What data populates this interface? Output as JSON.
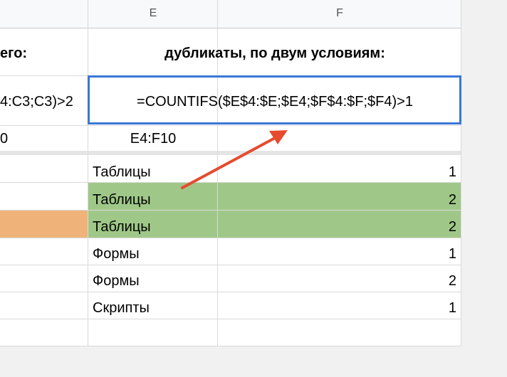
{
  "columns": {
    "e": "E",
    "f": "F"
  },
  "header_row": {
    "d_partial": "его:",
    "ef_title": "дубликаты, по двум условиям:"
  },
  "formula_row": {
    "d_partial": "4:C3;C3)>2",
    "ef_formula": "=COUNTIFS($E$4:$E;$E4;$F$4:$F;$F4)>1"
  },
  "range_row": {
    "d_partial": "0",
    "e_range": "E4:F10"
  },
  "rows": [
    {
      "e": "Таблицы",
      "f": "1",
      "highlight": false
    },
    {
      "e": "Таблицы",
      "f": "2",
      "highlight": true
    },
    {
      "e": "Таблицы",
      "f": "2",
      "highlight": true
    },
    {
      "e": "Формы",
      "f": "1",
      "highlight": false
    },
    {
      "e": "Формы",
      "f": "2",
      "highlight": false
    },
    {
      "e": "Скрипты",
      "f": "1",
      "highlight": false
    }
  ],
  "colors": {
    "header_bg": "#f8f9fa",
    "grid": "#d9d9d9",
    "green_highlight": "#9fc888",
    "orange_highlight": "#efb37a",
    "selection_border": "#3b76d6",
    "arrow": "#e64b30",
    "outside": "#f1f1f1"
  }
}
